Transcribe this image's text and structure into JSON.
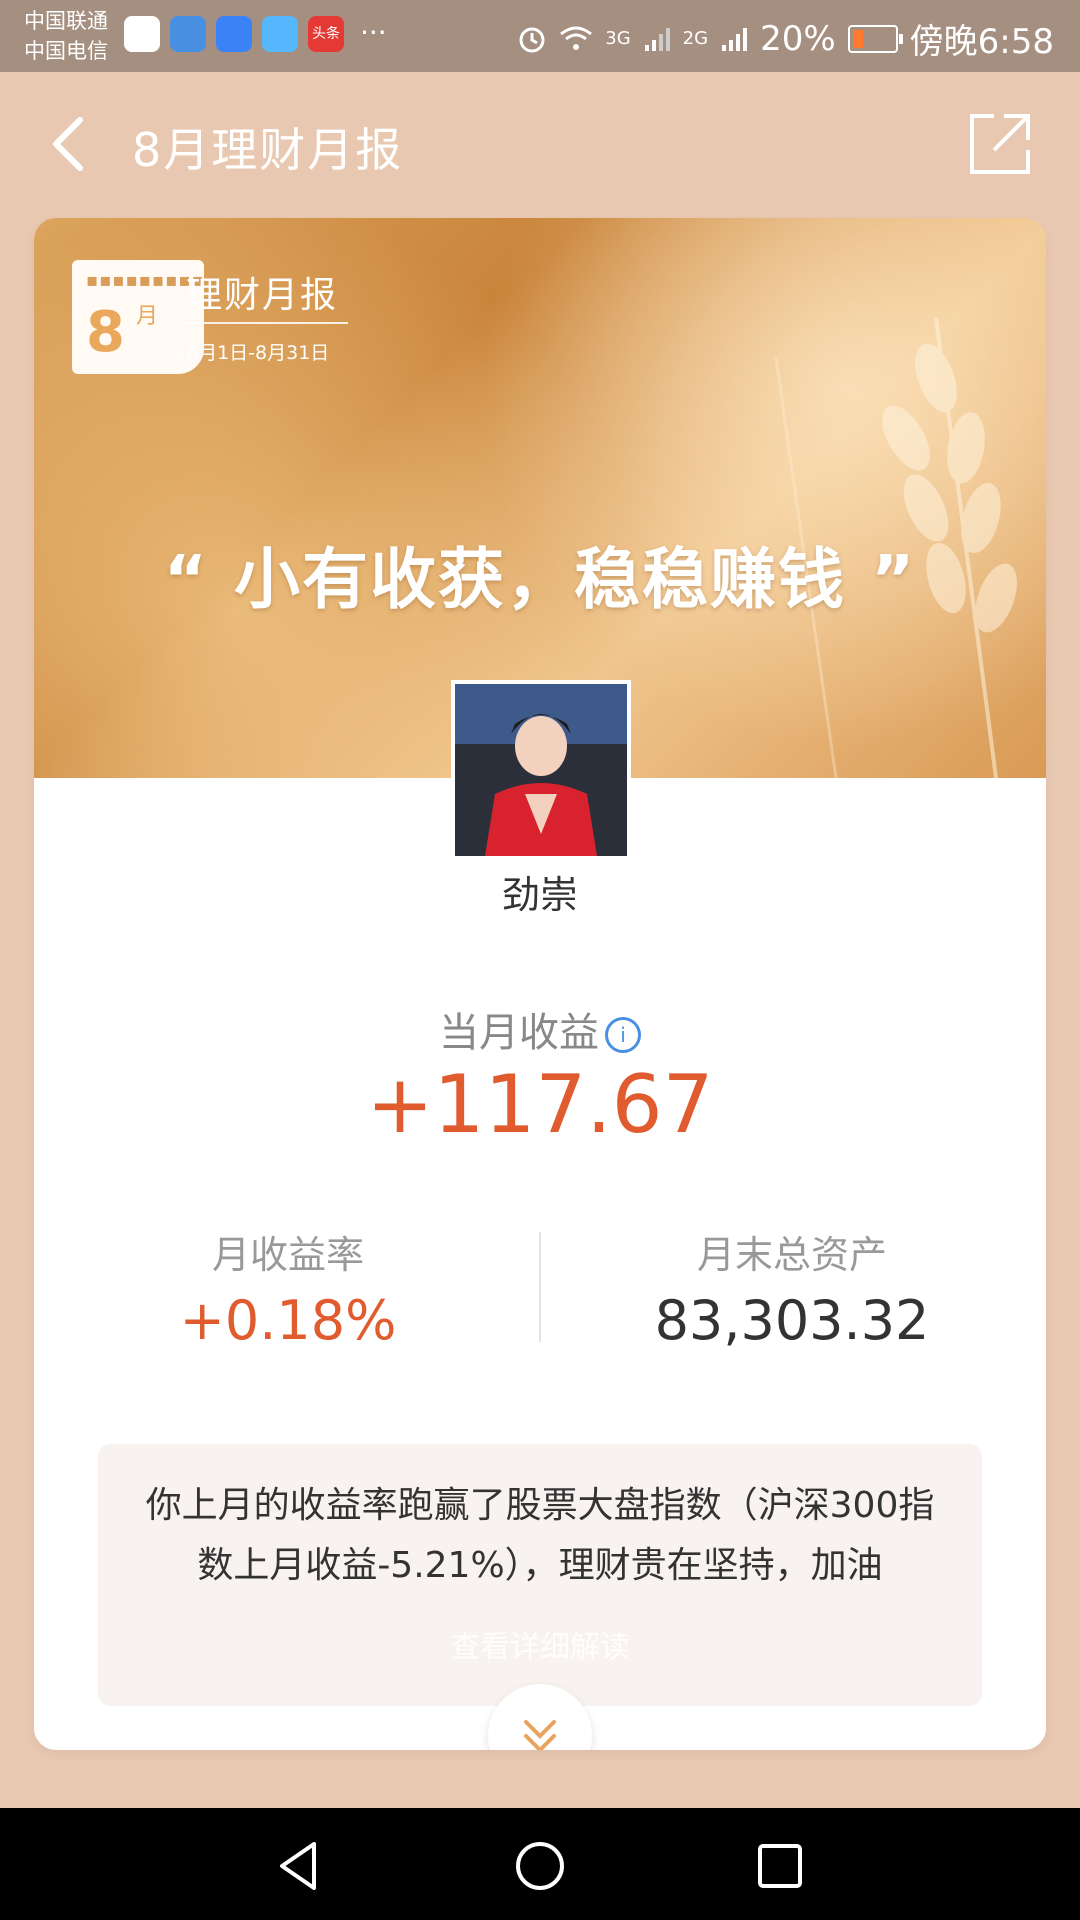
{
  "status_bar": {
    "carrier1": "中国联通",
    "carrier2": "中国电信",
    "notif_toutiao": "头条",
    "more": "···",
    "net1": "3G",
    "net2": "2G",
    "battery": "20%",
    "time": "傍晚6:58",
    "icons": [
      "alarm-icon",
      "wifi-icon",
      "signal-icon",
      "battery-icon"
    ]
  },
  "header": {
    "title": "8月理财月报",
    "back_icon": "back-arrow-icon",
    "share_icon": "share-icon"
  },
  "report": {
    "calendar_day": "8",
    "calendar_month": "月",
    "title": "理财月报",
    "date_range": "8月1日-8月31日",
    "slogan": "“ 小有收获，稳稳赚钱 ”",
    "username": "劲崇"
  },
  "income": {
    "label": "当月收益",
    "info_icon": "info-icon",
    "value": "+117.67"
  },
  "stats": {
    "rate_label": "月收益率",
    "rate_value": "+0.18%",
    "assets_label": "月末总资产",
    "assets_value": "83,303.32"
  },
  "note": {
    "text": "你上月的收益率跑赢了股票大盘指数（沪深300指数上月收益-5.21%），理财贵在坚持，加油",
    "overlay": "查看详细解读"
  },
  "colors": {
    "accent": "#e05b2e",
    "info": "#4a90e2",
    "background": "#e9c8b1"
  }
}
